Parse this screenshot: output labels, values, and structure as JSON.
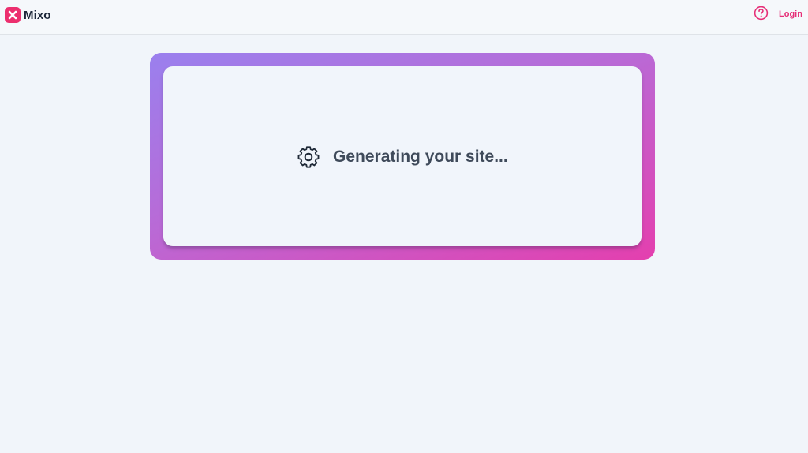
{
  "header": {
    "brand_name": "Mixo",
    "logo_icon": "close-x-icon",
    "help_icon": "question-circle-icon",
    "login_label": "Login"
  },
  "main": {
    "status_icon": "gear-icon",
    "status_text": "Generating your site..."
  },
  "colors": {
    "brand": "#ec2f6e",
    "accent_link": "#e62f77",
    "gradient_start": "#9a80ee",
    "gradient_end": "#e43fae",
    "text": "#3f4a5a",
    "background": "#f1f5fa"
  }
}
